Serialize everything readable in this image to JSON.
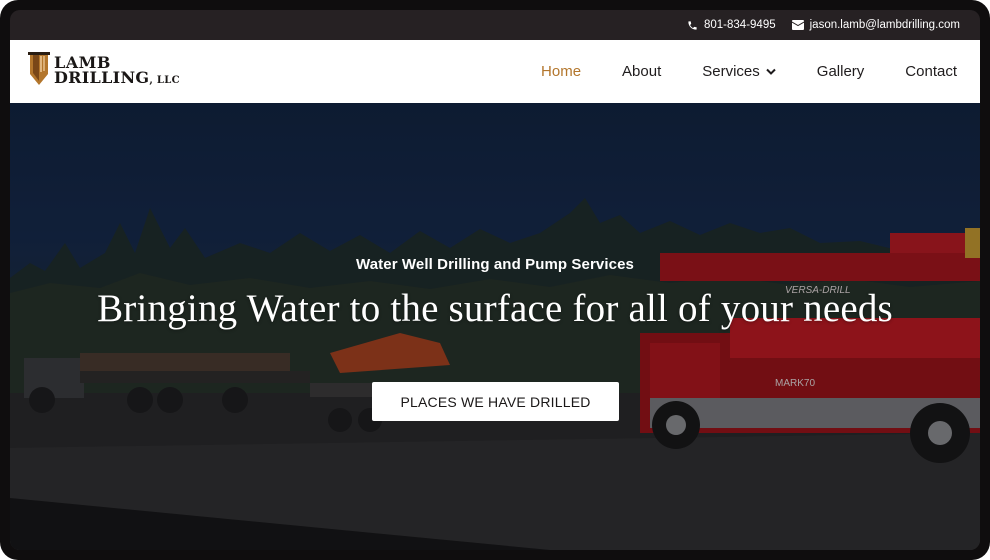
{
  "topbar": {
    "phone": "801-834-9495",
    "phone_icon": "phone-icon",
    "email": "jason.lamb@lambdrilling.com",
    "email_icon": "envelope-icon"
  },
  "logo": {
    "line1": "LAMB",
    "line2": "DRILLING",
    "suffix": ", LLC"
  },
  "nav": {
    "items": [
      {
        "label": "Home",
        "active": true
      },
      {
        "label": "About"
      },
      {
        "label": "Services",
        "has_dropdown": true
      },
      {
        "label": "Gallery"
      },
      {
        "label": "Contact"
      }
    ],
    "active_color": "#b3762c"
  },
  "hero": {
    "subtitle": "Water Well Drilling and Pump Services",
    "headline": "Bringing Water to the surface for all of your needs",
    "cta_label": "PLACES WE HAVE DRILLED",
    "truck_labels": [
      "VERSA-DRILL",
      "MARK70"
    ]
  },
  "colors": {
    "topbar_bg": "#262123",
    "accent": "#b3762c",
    "rig_red": "#b0141b"
  }
}
